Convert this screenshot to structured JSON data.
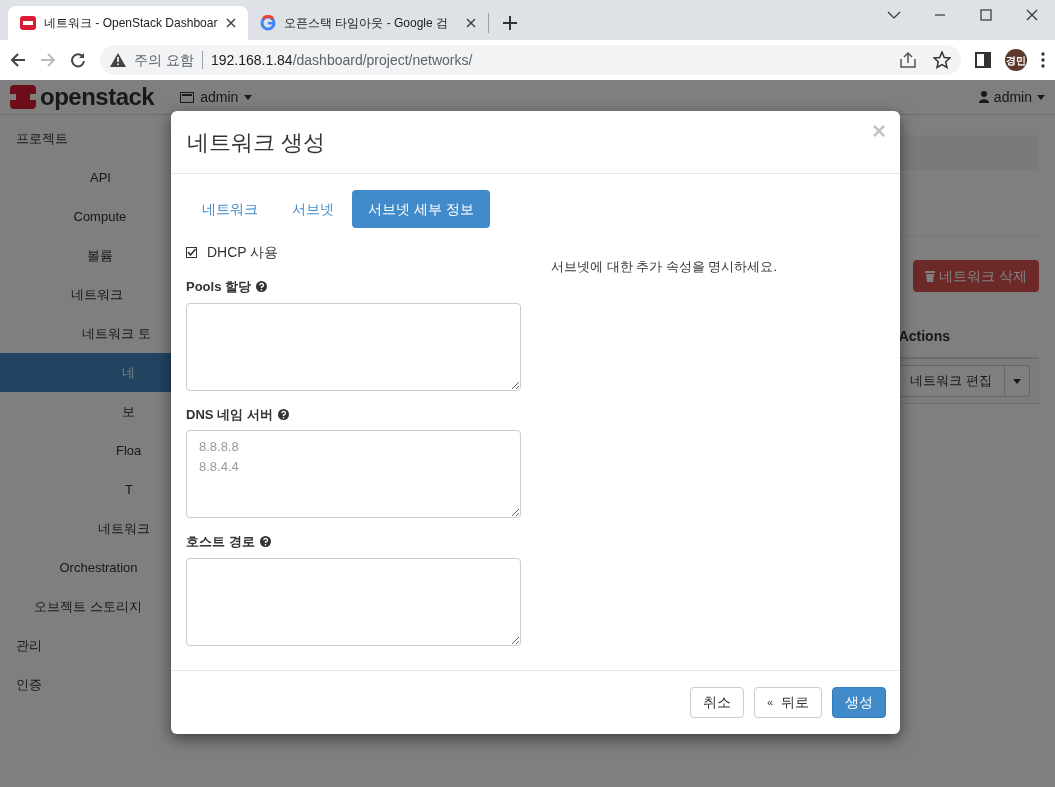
{
  "browser": {
    "tabs": [
      {
        "title": "네트워크 - OpenStack Dashboar",
        "kind": "openstack",
        "selected": true
      },
      {
        "title": "오픈스택 타임아웃 - Google 검",
        "kind": "google",
        "selected": false
      }
    ],
    "security_warning": "주의 요함",
    "url_host": "192.168.1.84",
    "url_path": "/dashboard/project/networks/",
    "profile": "경민"
  },
  "app": {
    "brand": "openstack",
    "project_menu": "admin",
    "user_menu": "admin",
    "sidebar": [
      {
        "label": "프로젝트",
        "selected": false,
        "children": [
          {
            "label": "API",
            "selected": false
          },
          {
            "label": "Compute",
            "selected": false
          },
          {
            "label": "볼륨",
            "selected": false
          },
          {
            "label": "네트워크",
            "selected": false,
            "children": [
              {
                "label": "네트워크 토",
                "selected": false
              },
              {
                "label": "네",
                "selected": true
              },
              {
                "label": "보",
                "selected": false
              },
              {
                "label": "Floa",
                "selected": false
              },
              {
                "label": "T",
                "selected": false
              },
              {
                "label": "네트워크",
                "selected": false
              }
            ]
          },
          {
            "label": "Orchestration",
            "selected": false
          },
          {
            "label": "오브젝트 스토리지",
            "selected": false
          }
        ]
      },
      {
        "label": "관리",
        "selected": false
      },
      {
        "label": "인증",
        "selected": false
      }
    ],
    "delete_button": "네트워크 삭제",
    "table_header": "Actions",
    "row_action": "네트워크 편집"
  },
  "modal": {
    "title": "네트워크 생성",
    "close": "×",
    "tabs": [
      {
        "label": "네트워크",
        "selected": false
      },
      {
        "label": "서브넷",
        "selected": false
      },
      {
        "label": "서브넷 세부 정보",
        "selected": true
      }
    ],
    "dhcp": {
      "label": "DHCP 사용",
      "checked": true
    },
    "fields": [
      {
        "label": "Pools 할당"
      },
      {
        "label": "DNS 네임 서버",
        "placeholder": "8.8.8.8\n8.8.4.4"
      },
      {
        "label": "호스트 경로"
      }
    ],
    "help": "서브넷에 대한 추가 속성을 명시하세요.",
    "buttons": [
      {
        "label": "취소",
        "kind": "default"
      },
      {
        "label": "뒤로",
        "kind": "back",
        "icon": "«"
      },
      {
        "label": "생성",
        "kind": "primary"
      }
    ]
  }
}
